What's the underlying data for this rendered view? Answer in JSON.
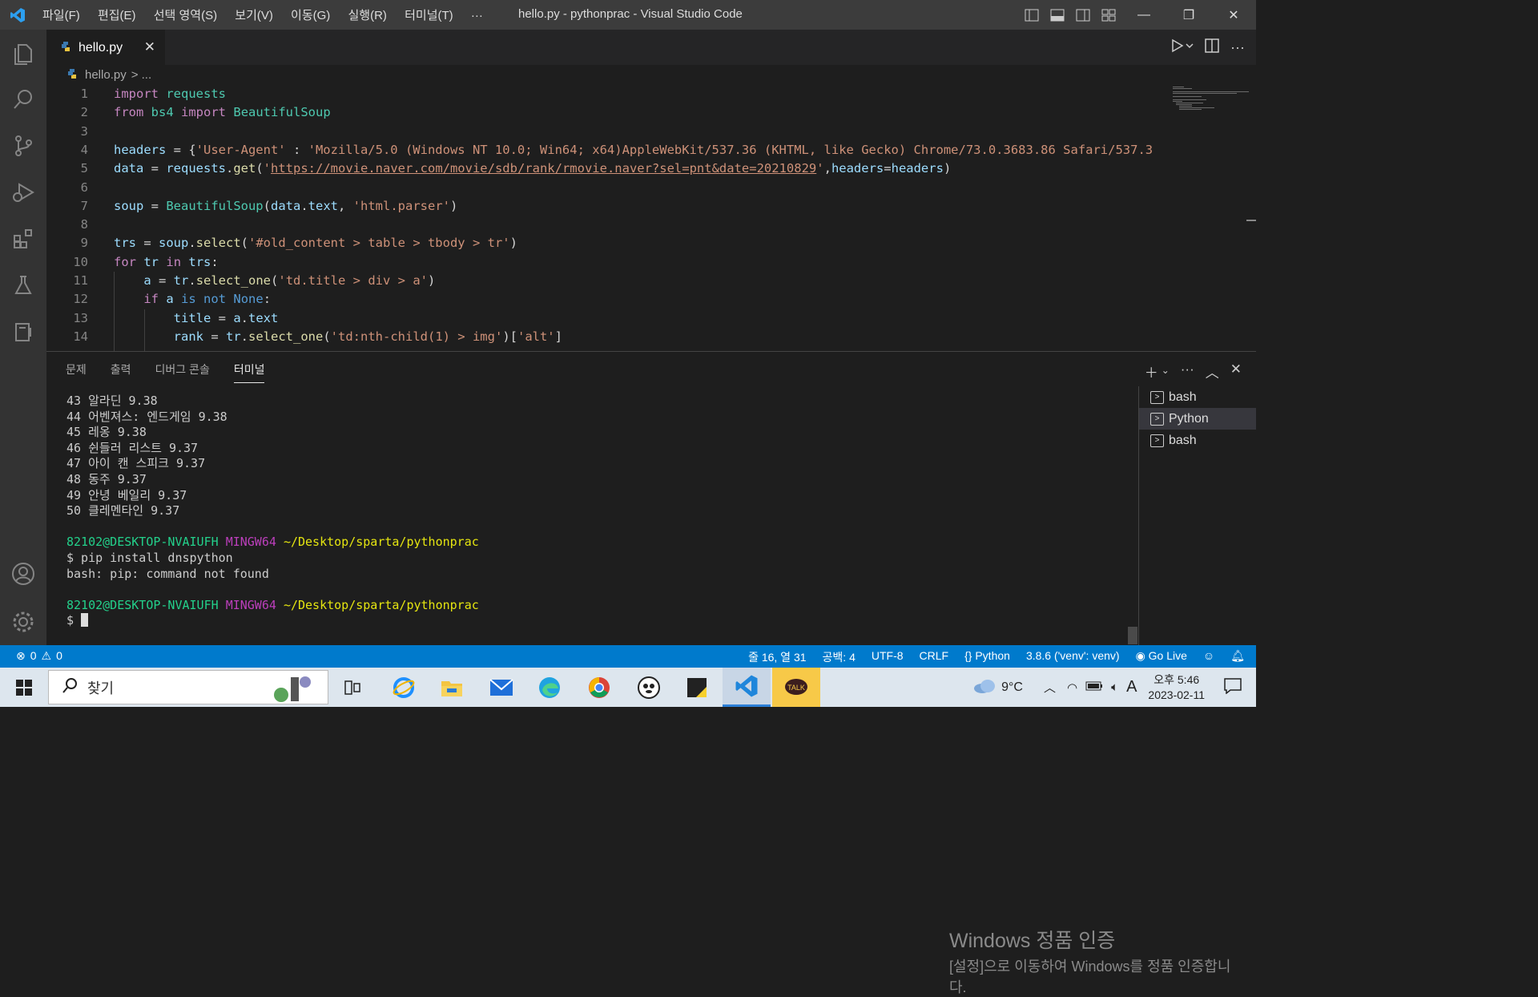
{
  "titlebar": {
    "menus": [
      "파일(F)",
      "편집(E)",
      "선택 영역(S)",
      "보기(V)",
      "이동(G)",
      "실행(R)",
      "터미널(T)",
      "···"
    ],
    "title": "hello.py - pythonprac - Visual Studio Code"
  },
  "tab": {
    "filename": "hello.py",
    "close": "✕"
  },
  "breadcrumb": {
    "file": "hello.py",
    "rest": "> ..."
  },
  "editor": {
    "line_numbers": [
      "1",
      "2",
      "3",
      "4",
      "5",
      "6",
      "7",
      "8",
      "9",
      "10",
      "11",
      "12",
      "13",
      "14"
    ],
    "lines": [
      "import requests",
      "from bs4 import BeautifulSoup",
      "",
      "headers = {'User-Agent' : 'Mozilla/5.0 (Windows NT 10.0; Win64; x64)AppleWebKit/537.36 (KHTML, like Gecko) Chrome/73.0.3683.86 Safari/537.3",
      "data = requests.get('https://movie.naver.com/movie/sdb/rank/rmovie.naver?sel=pnt&date=20210829',headers=headers)",
      "",
      "soup = BeautifulSoup(data.text, 'html.parser')",
      "",
      "trs = soup.select('#old_content > table > tbody > tr')",
      "for tr in trs:",
      "    a = tr.select_one('td.title > div > a')",
      "    if a is not None:",
      "        title = a.text",
      "        rank = tr.select_one('td:nth-child(1) > img')['alt']"
    ]
  },
  "panel": {
    "tabs": [
      "문제",
      "출력",
      "디버그 콘솔",
      "터미널"
    ],
    "active_tab": "터미널"
  },
  "terminal": {
    "lines": [
      "43 알라딘 9.38",
      "44 어벤져스: 엔드게임 9.38",
      "45 레옹 9.38",
      "46 쉰들러 리스트 9.37",
      "47 아이 캔 스피크 9.37",
      "48 동주 9.37",
      "49 안녕 베일리 9.37",
      "50 클레멘타인 9.37"
    ],
    "prompt_user": "82102@DESKTOP-NVAIUFH",
    "prompt_env": "MINGW64",
    "prompt_path": "~/Desktop/sparta/pythonprac",
    "command": "$ pip install dnspython",
    "error": "bash: pip: command not found",
    "cursor_prompt": "$ "
  },
  "terminal_list": [
    "bash",
    "Python",
    "bash"
  ],
  "selected_terminal": "Python",
  "watermark": {
    "title": "Windows 정품 인증",
    "line1": "[설정]으로 이동하여 Windows를 정품 인증합니",
    "line2": "다."
  },
  "statusbar": {
    "errors": "0",
    "warnings": "0",
    "position": "줄 16, 열 31",
    "spaces": "공백: 4",
    "encoding": "UTF-8",
    "eol": "CRLF",
    "language": "Python",
    "interpreter": "3.8.6 ('venv': venv)",
    "golive": "Go Live"
  },
  "taskbar": {
    "search_placeholder": "찾기",
    "temperature": "9°C",
    "time": "오후 5:46",
    "date": "2023-02-11",
    "ime": "A"
  },
  "colors": {
    "accent": "#007acc",
    "activity": "#333333",
    "editor_bg": "#1e1e1e"
  }
}
